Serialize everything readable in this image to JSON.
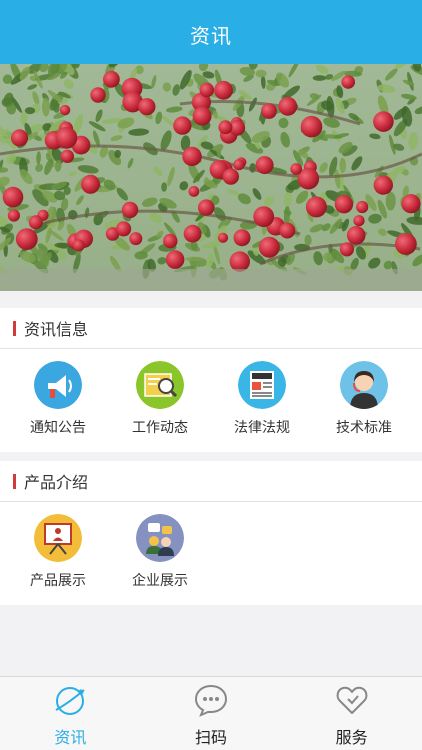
{
  "header": {
    "title": "资讯"
  },
  "banner": {
    "icon": "apple-orchard-photo"
  },
  "sections": [
    {
      "title": "资讯信息",
      "items": [
        {
          "label": "通知公告",
          "icon": "megaphone-icon"
        },
        {
          "label": "工作动态",
          "icon": "magnifier-icon"
        },
        {
          "label": "法律法规",
          "icon": "newspaper-icon"
        },
        {
          "label": "技术标准",
          "icon": "support-agent-icon"
        }
      ]
    },
    {
      "title": "产品介绍",
      "items": [
        {
          "label": "产品展示",
          "icon": "presentation-icon"
        },
        {
          "label": "企业展示",
          "icon": "team-icon"
        }
      ]
    }
  ],
  "tabbar": {
    "tabs": [
      {
        "label": "资讯",
        "icon": "planet-icon",
        "active": true
      },
      {
        "label": "扫码",
        "icon": "chat-bubble-icon",
        "active": false
      },
      {
        "label": "服务",
        "icon": "heart-icon",
        "active": false
      }
    ]
  },
  "colors": {
    "accent": "#2aaee6",
    "section_marker": "#d23b3b",
    "background": "#f2f2f5"
  }
}
